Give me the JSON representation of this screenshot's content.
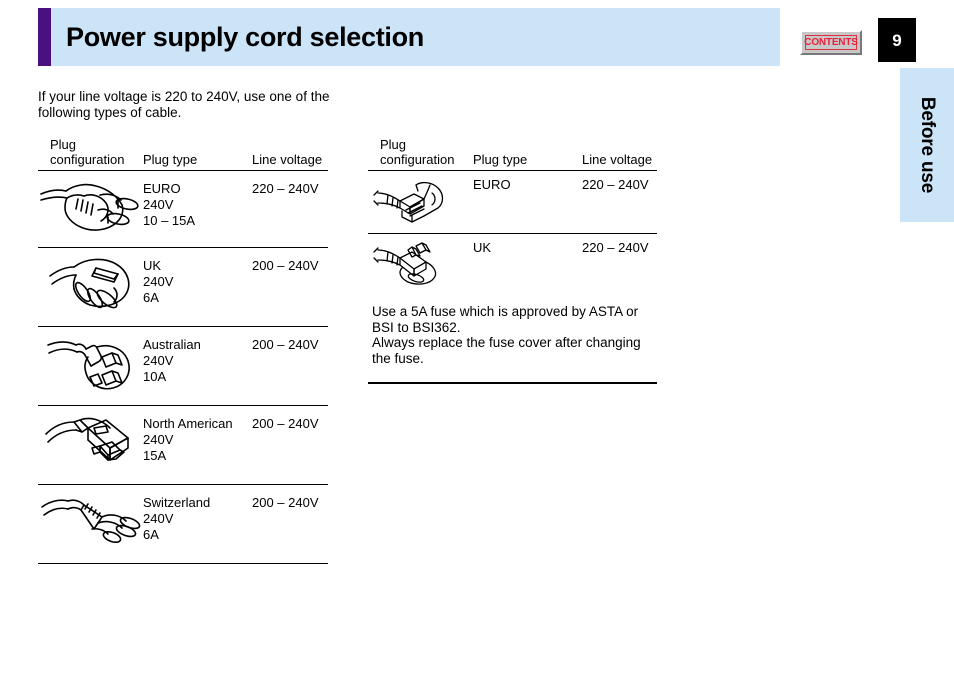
{
  "header": {
    "title": "Power supply cord selection",
    "contents_button_label": "CONTENTS",
    "page_number": "9",
    "accent_color": "#4b1080",
    "banner_color": "#cce4f7",
    "contents_text_color": "#e8203a"
  },
  "side_tab": {
    "label": "Before use",
    "color": "#cce4f7"
  },
  "intro": {
    "text": "If your line voltage is 220 to 240V, use one of the following types of cable."
  },
  "left_table": {
    "headers": {
      "configuration": "Plug\nconfiguration",
      "plug_type": "Plug type",
      "line_voltage": "Line voltage"
    },
    "rows": [
      {
        "figure": "euro-plug-icon",
        "plug_type": "EURO\n240V\n10 – 15A",
        "line_voltage": "220 – 240V"
      },
      {
        "figure": "uk-plug-icon",
        "plug_type": "UK\n240V\n6A",
        "line_voltage": "200 – 240V"
      },
      {
        "figure": "australian-plug-icon",
        "plug_type": "Australian\n240V\n10A",
        "line_voltage": "200 – 240V"
      },
      {
        "figure": "north-american-plug-icon",
        "plug_type": "North American\n240V\n15A",
        "line_voltage": "200 – 240V"
      },
      {
        "figure": "switzerland-plug-icon",
        "plug_type": "Switzerland\n240V\n6A",
        "line_voltage": "200 – 240V"
      }
    ]
  },
  "right_table": {
    "headers": {
      "configuration": "Plug\nconfiguration",
      "plug_type": "Plug type",
      "line_voltage": "Line voltage"
    },
    "rows": [
      {
        "figure": "euro-angled-plug-icon",
        "plug_type": "EURO",
        "line_voltage": "220 – 240V"
      },
      {
        "figure": "uk-angled-plug-icon",
        "plug_type": "UK",
        "line_voltage": "220 – 240V"
      }
    ],
    "note": "Use a 5A fuse which is approved by ASTA or BSI to BSI362.\nAlways replace the fuse cover after changing the fuse."
  }
}
